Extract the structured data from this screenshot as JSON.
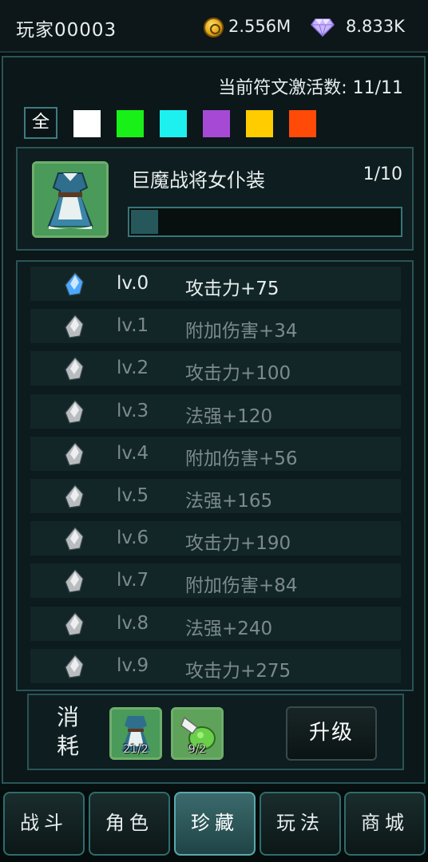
{
  "header": {
    "player_name": "玩家00003",
    "coin_value": "2.556M",
    "gem_value": "8.833K",
    "coin_icon": "gold-coin-icon",
    "gem_icon": "diamond-icon"
  },
  "rune_panel": {
    "active_count_label": "当前符文激活数: 11/11",
    "filter_all_label": "全",
    "filter_colors": [
      "#ffffff",
      "#18f018",
      "#1ef0f0",
      "#a64ad6",
      "#ffcc00",
      "#ff4a08"
    ]
  },
  "item": {
    "name": "巨魔战将女仆装",
    "progress_text": "1/10",
    "progress_value": 0.1,
    "portrait_icon": "maid-outfit-icon"
  },
  "levels": [
    {
      "lv": "lv.0",
      "attr": "攻击力+75",
      "active": true
    },
    {
      "lv": "lv.1",
      "attr": "附加伤害+34",
      "active": false
    },
    {
      "lv": "lv.2",
      "attr": "攻击力+100",
      "active": false
    },
    {
      "lv": "lv.3",
      "attr": "法强+120",
      "active": false
    },
    {
      "lv": "lv.4",
      "attr": "附加伤害+56",
      "active": false
    },
    {
      "lv": "lv.5",
      "attr": "法强+165",
      "active": false
    },
    {
      "lv": "lv.6",
      "attr": "攻击力+190",
      "active": false
    },
    {
      "lv": "lv.7",
      "attr": "附加伤害+84",
      "active": false
    },
    {
      "lv": "lv.8",
      "attr": "法强+240",
      "active": false
    },
    {
      "lv": "lv.9",
      "attr": "攻击力+275",
      "active": false
    }
  ],
  "cost": {
    "label_top": "消",
    "label_bottom": "耗",
    "items": [
      {
        "icon": "maid-outfit-icon",
        "count": "21/2"
      },
      {
        "icon": "potion-bag-icon",
        "count": "9/2"
      }
    ],
    "upgrade_label": "升级"
  },
  "nav": {
    "tabs": [
      {
        "label": "战斗",
        "active": false
      },
      {
        "label": "角色",
        "active": false
      },
      {
        "label": "珍藏",
        "active": true
      },
      {
        "label": "玩法",
        "active": false
      },
      {
        "label": "商城",
        "active": false
      }
    ]
  }
}
